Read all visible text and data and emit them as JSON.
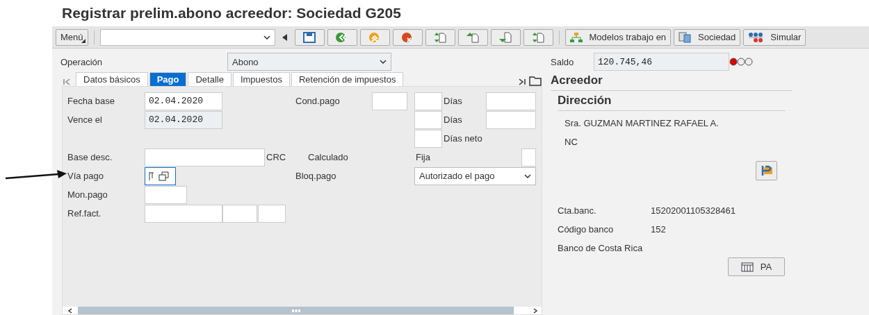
{
  "window": {
    "title": "Registrar prelim.abono acreedor: Sociedad G205"
  },
  "toolbar": {
    "menu": "Menú",
    "icon_buttons": [
      {
        "kind": "save"
      },
      {
        "kind": "back"
      },
      {
        "kind": "exit"
      },
      {
        "kind": "cancel"
      },
      {
        "kind": "swap"
      },
      {
        "kind": "up"
      },
      {
        "kind": "down"
      },
      {
        "kind": "swap"
      }
    ],
    "text_buttons": [
      {
        "kind": "hierarchy",
        "label": "Modelos trabajo en"
      },
      {
        "kind": "company",
        "label": "Sociedad"
      },
      {
        "kind": "simulate",
        "label": "Simular"
      }
    ]
  },
  "operation": {
    "label": "Operación",
    "value": "Abono"
  },
  "tabs": [
    {
      "label": "Datos básicos",
      "selected": false
    },
    {
      "label": "Pago",
      "selected": true
    },
    {
      "label": "Detalle",
      "selected": false
    },
    {
      "label": "Impuestos",
      "selected": false
    },
    {
      "label": "Retención de impuestos",
      "selected": false
    }
  ],
  "payment": {
    "fecha_base": {
      "label": "Fecha base",
      "value": "02.04.2020"
    },
    "vence_el": {
      "label": "Vence el",
      "value": "02.04.2020"
    },
    "cond_pago": "Cond.pago",
    "dias_1": "Días",
    "dias_2": "Días",
    "dias_neto": "Días neto",
    "base_desc": "Base desc.",
    "currency": "CRC",
    "calculado": "Calculado",
    "fija": "Fija",
    "via_pago": "Vía pago",
    "bloq_pago": {
      "label": "Bloq.pago",
      "value": "Autorizado el pago"
    },
    "mon_pago": "Mon.pago",
    "ref_fact": "Ref.fact."
  },
  "saldo": {
    "label": "Saldo",
    "value": "120.745,46",
    "alert": true
  },
  "acreedor": {
    "title": "Acreedor",
    "section": "Dirección",
    "lines": [
      "Sra. GUZMAN MARTINEZ RAFAEL A.",
      "NC"
    ],
    "bank": [
      {
        "label": "Cta.banc.",
        "value": "15202001105328461"
      },
      {
        "label": "Código banco",
        "value": "152"
      }
    ],
    "bank_name": "Banco de Costa Rica",
    "pa_button": "PA"
  }
}
